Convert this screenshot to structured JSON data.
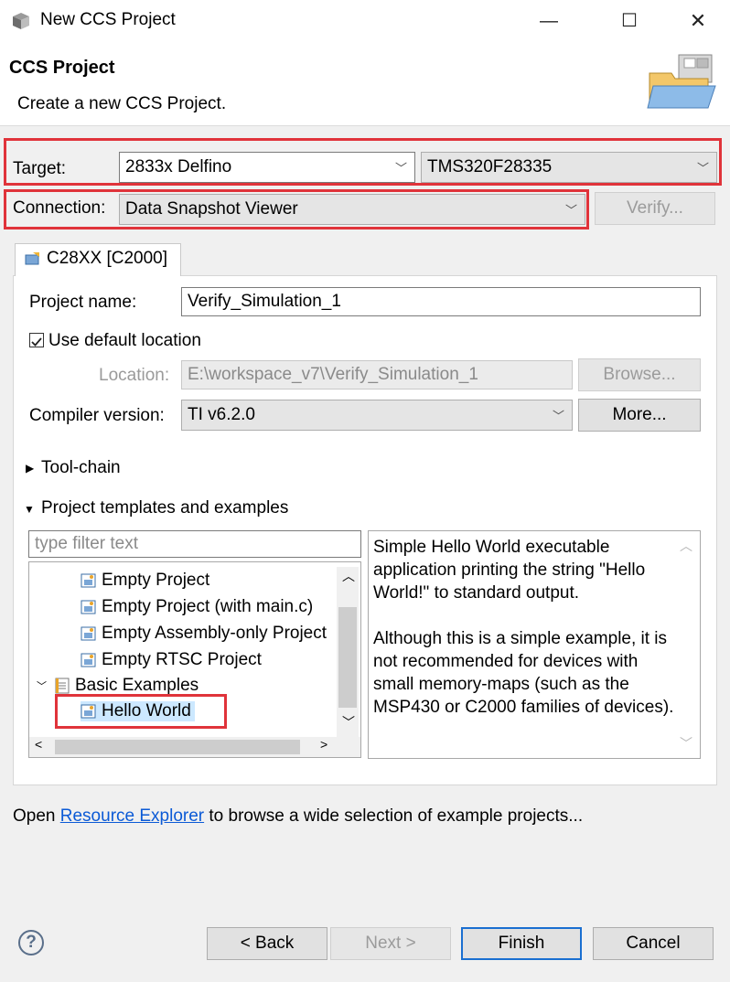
{
  "window": {
    "title": "New CCS Project",
    "minimize_icon": "minimize-icon",
    "maximize_icon": "maximize-icon",
    "close_icon": "close-icon"
  },
  "header": {
    "title": "CCS Project",
    "description": "Create a new CCS Project."
  },
  "target": {
    "label": "Target:",
    "family_value": "2833x Delfino",
    "device_value": "TMS320F28335"
  },
  "connection": {
    "label": "Connection:",
    "value": "Data Snapshot Viewer",
    "verify_label": "Verify..."
  },
  "tab": {
    "label": "C28XX [C2000]"
  },
  "project": {
    "name_label": "Project name:",
    "name_value": "Verify_Simulation_1",
    "use_default_location_label": "Use default location",
    "use_default_location_checked": true,
    "location_label": "Location:",
    "location_value": "E:\\workspace_v7\\Verify_Simulation_1",
    "browse_label": "Browse...",
    "compiler_label": "Compiler version:",
    "compiler_value": "TI v6.2.0",
    "more_label": "More..."
  },
  "sections": {
    "toolchain": "Tool-chain",
    "templates": "Project templates and examples"
  },
  "templates": {
    "filter_placeholder": "type filter text",
    "items": [
      {
        "label": "Empty Project"
      },
      {
        "label": "Empty Project (with main.c)"
      },
      {
        "label": "Empty Assembly-only Project"
      },
      {
        "label": "Empty RTSC Project"
      },
      {
        "label": "Basic Examples"
      },
      {
        "label": "Hello World"
      }
    ],
    "description": "Simple Hello World executable application printing the string \"Hello World!\" to standard output.\n\nAlthough this is a simple example, it is not recommended for devices with small memory-maps (such as the MSP430 or C2000 families of devices)."
  },
  "footer": {
    "open_prefix": "Open ",
    "link_text": "Resource Explorer",
    "open_suffix": " to browse a wide selection of example projects..."
  },
  "buttons": {
    "back": "< Back",
    "next": "Next >",
    "finish": "Finish",
    "cancel": "Cancel"
  },
  "colors": {
    "highlight": "#e0333a",
    "link": "#0b5ad6",
    "selection": "#cce8ff"
  }
}
